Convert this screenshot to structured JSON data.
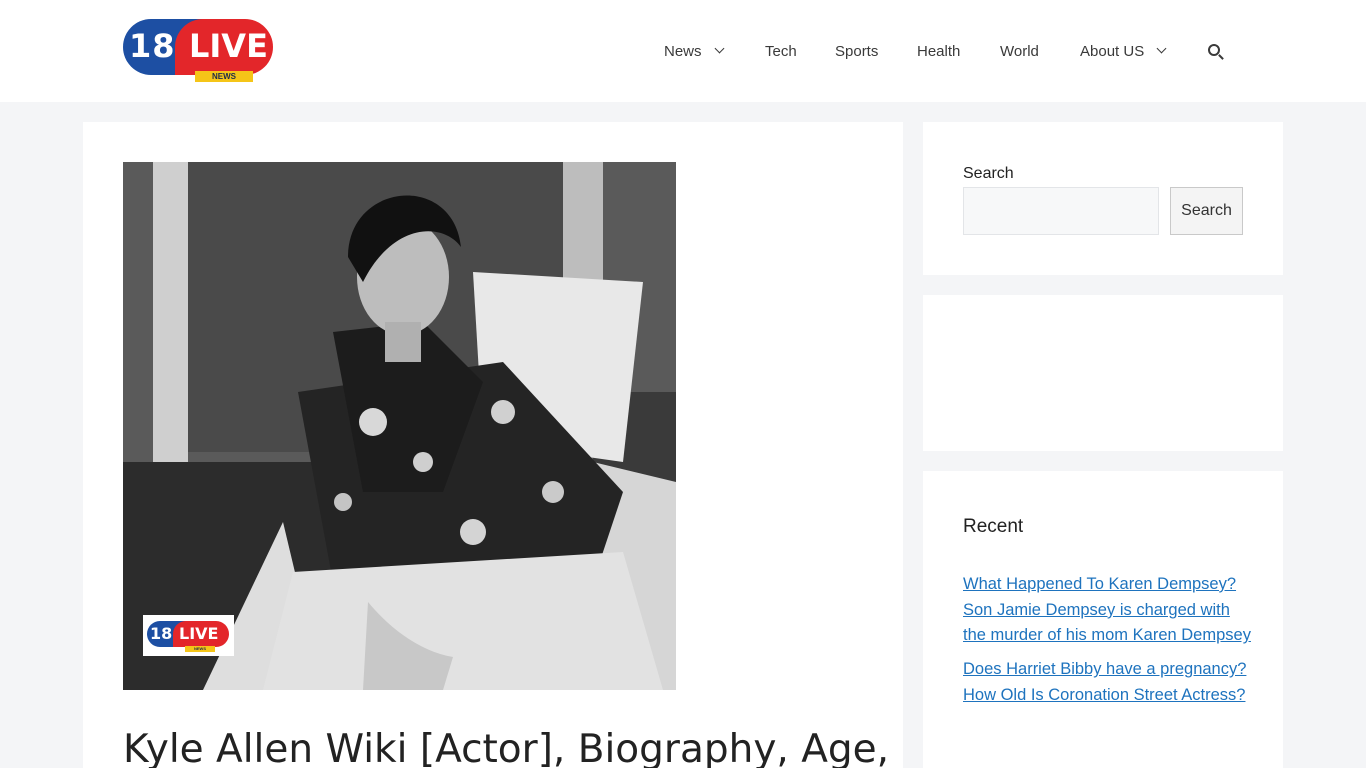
{
  "header": {
    "logo": {
      "number": "18",
      "word": "LIVE",
      "tagline": "NEWS"
    },
    "nav": [
      {
        "label": "News",
        "has_dropdown": true
      },
      {
        "label": "Tech",
        "has_dropdown": false
      },
      {
        "label": "Sports",
        "has_dropdown": false
      },
      {
        "label": "Health",
        "has_dropdown": false
      },
      {
        "label": "World",
        "has_dropdown": false
      },
      {
        "label": "About US",
        "has_dropdown": true
      }
    ],
    "search_icon": "search-icon"
  },
  "article": {
    "featured_image_alt": "Black and white portrait of a man in a floral shirt sitting on a white chair",
    "image_watermark": {
      "number": "18",
      "word": "LIVE",
      "tagline": "NEWS"
    },
    "title": "Kyle Allen Wiki [Actor], Biography, Age,"
  },
  "sidebar": {
    "search": {
      "label": "Search",
      "placeholder": "",
      "button_label": "Search"
    },
    "recent": {
      "title": "Recent",
      "posts": [
        "What Happened To Karen Dempsey? Son Jamie Dempsey is charged with the murder of his mom Karen Dempsey",
        "Does Harriet Bibby have a pregnancy? How Old Is Coronation Street Actress?"
      ]
    }
  },
  "colors": {
    "brand_blue": "#1d4fa3",
    "brand_red": "#e3262a",
    "brand_yellow": "#f5c518",
    "link": "#1e73be",
    "page_bg": "#f4f5f7"
  }
}
